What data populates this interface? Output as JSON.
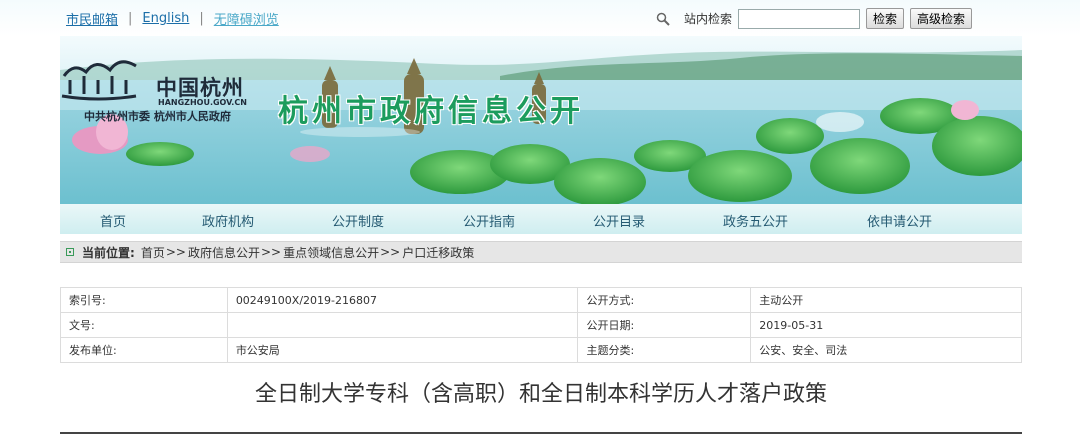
{
  "top_links": {
    "mail": "市民邮箱",
    "english": "English",
    "accessible": "无障碍浏览",
    "separator": "|"
  },
  "search": {
    "label": "站内检索",
    "placeholder": "",
    "search_button": "检索",
    "advanced_button": "高级检索"
  },
  "banner": {
    "logo_cn": "中国杭州",
    "logo_en": "HANGZHOU.GOV.CN",
    "logo_org": "中共杭州市委  杭州市人民政府",
    "title": "杭州市政府信息公开"
  },
  "nav": {
    "items": [
      "首页",
      "政府机构",
      "公开制度",
      "公开指南",
      "公开目录",
      "政务五公开",
      "依申请公开"
    ]
  },
  "breadcrumb": {
    "current_label": "当前位置:",
    "items": [
      "首页",
      "政府信息公开",
      "重点领域信息公开",
      "户口迁移政策"
    ],
    "arrow": ">>"
  },
  "info": {
    "rows": [
      [
        "索引号:",
        "00249100X/2019-216807",
        "公开方式:",
        "主动公开"
      ],
      [
        "文号:",
        "",
        "公开日期:",
        "2019-05-31"
      ],
      [
        "发布单位:",
        "市公安局",
        "主题分类:",
        "公安、安全、司法"
      ]
    ]
  },
  "document": {
    "title": "全日制大学专科（含高职）和全日制本科学历人才落户政策"
  },
  "colors": {
    "title_green": "#1c9c5d",
    "link_blue": "#1b6ea8",
    "nav_text": "#245a72"
  }
}
